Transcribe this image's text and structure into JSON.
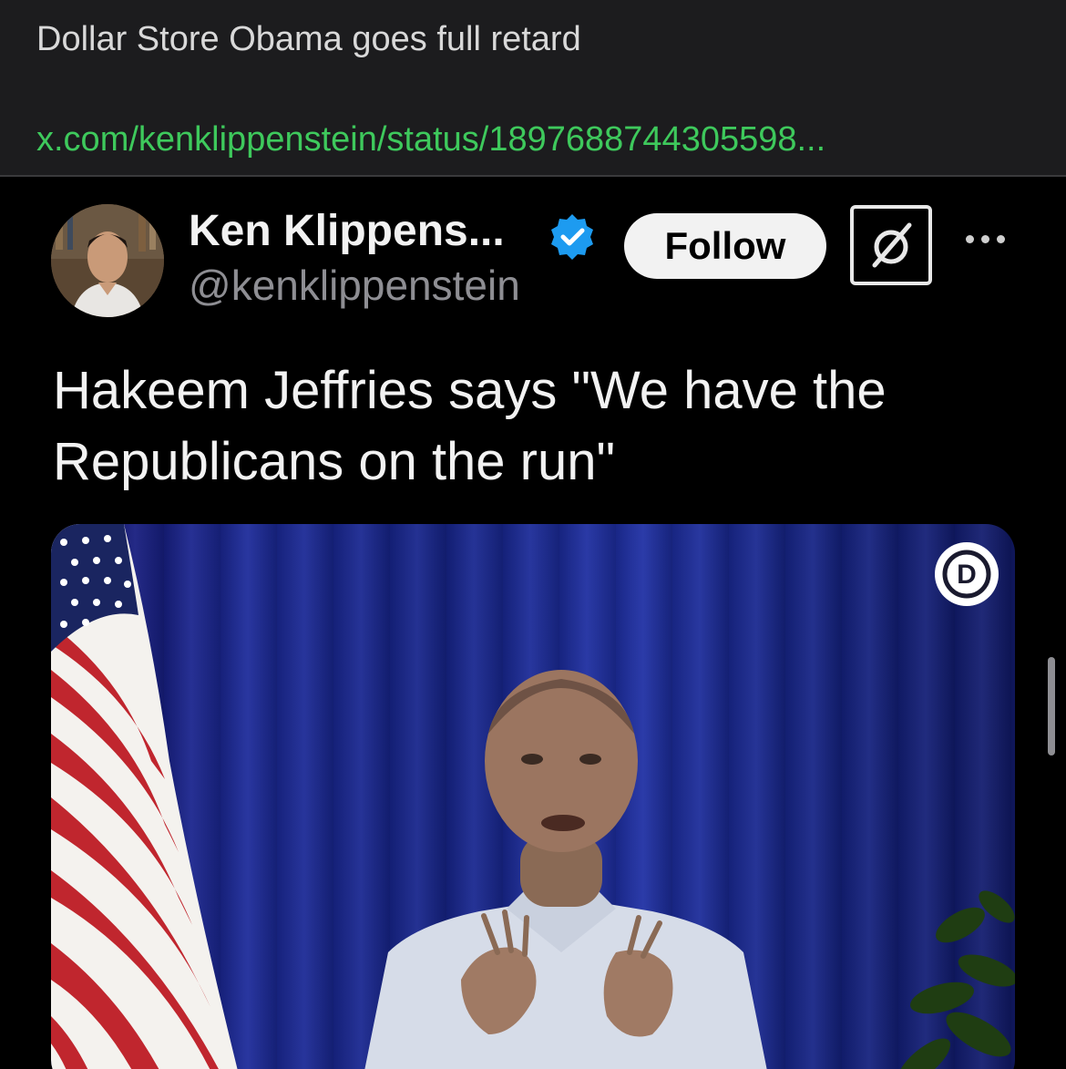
{
  "post": {
    "title": "Dollar Store Obama goes full retard",
    "link_text": "x.com/kenklippenstein/status/1897688744305598..."
  },
  "embed": {
    "author_name": "Ken Klippens...",
    "author_handle": "@kenklippenstein",
    "follow_label": "Follow",
    "tweet_lines": [
      "Hakeem Jeffries says \"We have the",
      "Republicans on the run\""
    ],
    "media_badge": "D"
  },
  "icons": {
    "verified": "verified-badge-icon",
    "x_logo": "x-logo-icon",
    "more": "more-horizontal-icon",
    "dem_logo": "democrat-logo-icon"
  },
  "colors": {
    "background": "#1c1c1e",
    "embed_background": "#000000",
    "link": "#3ec95c",
    "verified": "#1d9bf0",
    "handle": "#8e8e93"
  }
}
